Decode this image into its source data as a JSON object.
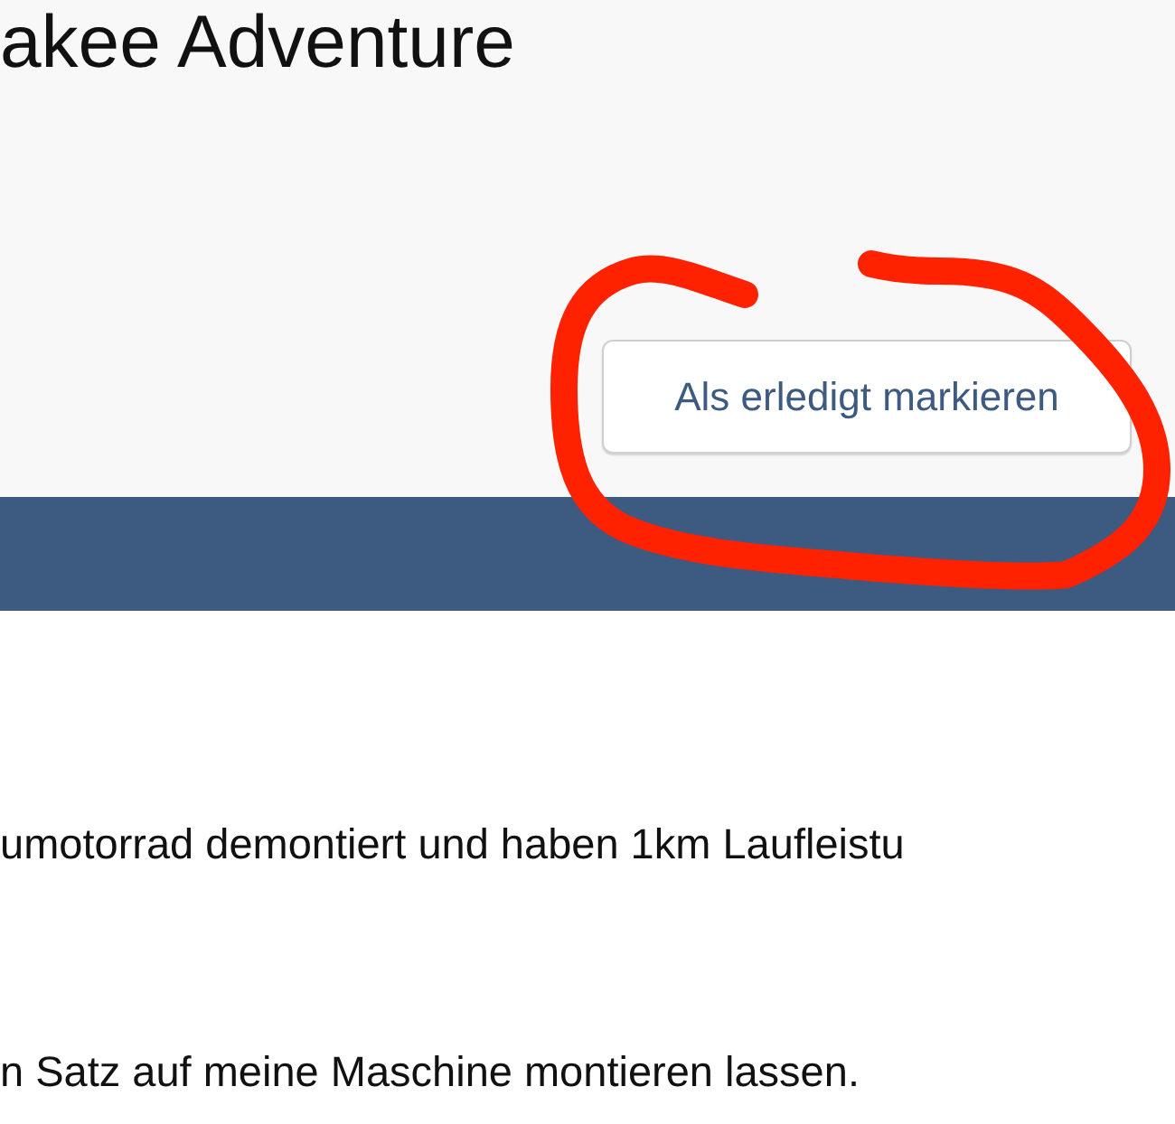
{
  "header": {
    "title": "akee Adventure",
    "button": "Als erledigt markieren"
  },
  "paragraphs": [
    "umotorrad demontiert und haben 1km Laufleistu",
    "n Satz auf meine Maschine montieren lassen."
  ],
  "annotation": {
    "kind": "circle"
  }
}
